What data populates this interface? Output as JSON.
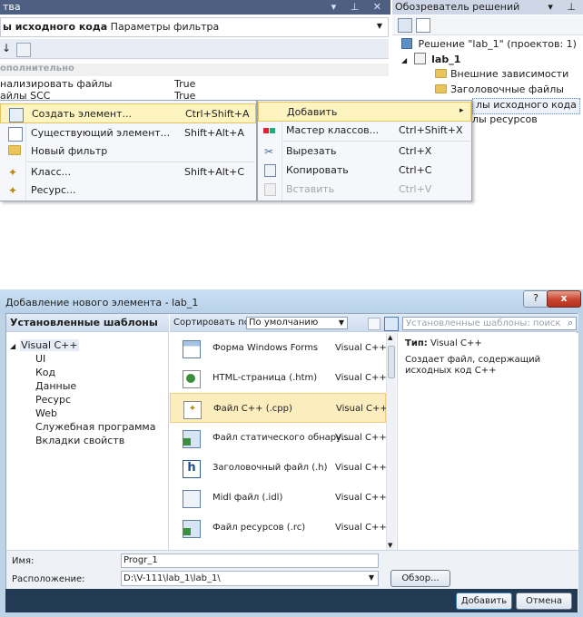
{
  "properties": {
    "title": "тва",
    "title_buttons": "▾ ⊥ ✕",
    "combo_bold": "ы исходного кода",
    "combo_text": "Параметры фильтра",
    "category": "ополнительно",
    "rows": [
      {
        "key": "нализировать файлы",
        "value": "True"
      },
      {
        "key": "айлы SCC",
        "value": "True"
      }
    ]
  },
  "solution_explorer": {
    "title": "Обозреватель решений",
    "title_buttons": "▾ ⊥",
    "tree": {
      "solution": "Решение \"lab_1\" (проектов: 1)",
      "project": "lab_1",
      "folder_external": "Внешние зависимости",
      "folder_headers": "Заголовочные файлы",
      "folder_source": "лы исходного кода",
      "folder_resources": "лы ресурсов"
    }
  },
  "menu1": {
    "items": [
      {
        "label": "Создать элемент...",
        "shortcut": "Ctrl+Shift+A",
        "icon": "new-item-icon"
      },
      {
        "label": "Существующий элемент...",
        "shortcut": "Shift+Alt+A",
        "icon": "existing-item-icon"
      },
      {
        "label": "Новый фильтр",
        "shortcut": "",
        "icon": "folder-icon"
      },
      {
        "label": "Класс...",
        "shortcut": "Shift+Alt+C",
        "icon": "class-icon"
      },
      {
        "label": "Ресурс...",
        "shortcut": "",
        "icon": "resource-icon"
      }
    ]
  },
  "menu2": {
    "items": [
      {
        "label": "Добавить",
        "shortcut": "▸",
        "icon": ""
      },
      {
        "label": "Мастер классов...",
        "shortcut": "Ctrl+Shift+X",
        "icon": "class-wizard-icon"
      },
      {
        "label": "Вырезать",
        "shortcut": "Ctrl+X",
        "icon": "cut-icon"
      },
      {
        "label": "Копировать",
        "shortcut": "Ctrl+C",
        "icon": "copy-icon"
      },
      {
        "label": "Вставить",
        "shortcut": "Ctrl+V",
        "icon": "paste-icon"
      }
    ]
  },
  "dialog": {
    "title": "Добавление нового элемента - lab_1",
    "help": "?",
    "close": "x",
    "installed_templates": "Установленные шаблоны",
    "tree": {
      "root": "Visual C++",
      "children": [
        "UI",
        "Код",
        "Данные",
        "Ресурс",
        "Web",
        "Служебная программа",
        "Вкладки свойств"
      ]
    },
    "sort_label": "Сортировать по:",
    "sort_value": "По умолчанию",
    "search_placeholder": "Установленные шаблоны: поиск",
    "templates": [
      {
        "name": "Форма Windows Forms",
        "lang": "Visual C++"
      },
      {
        "name": "HTML-страница (.htm)",
        "lang": "Visual C++"
      },
      {
        "name": "Файл C++ (.cpp)",
        "lang": "Visual C++"
      },
      {
        "name": "Файл статического обнару...",
        "lang": "Visual C++"
      },
      {
        "name": "Заголовочный файл (.h)",
        "lang": "Visual C++"
      },
      {
        "name": "Midl файл (.idl)",
        "lang": "Visual C++"
      },
      {
        "name": "Файл ресурсов (.rc)",
        "lang": "Visual C++"
      }
    ],
    "info_type_label": "Тип:",
    "info_type_value": "Visual C++",
    "info_desc": "Создает файл, содержащий исходных код C++",
    "name_label": "Имя:",
    "name_value": "Progr_1",
    "location_label": "Расположение:",
    "location_value": "D:\\V-111\\lab_1\\lab_1\\",
    "browse": "Обзор...",
    "add": "Добавить",
    "cancel": "Отмена"
  }
}
